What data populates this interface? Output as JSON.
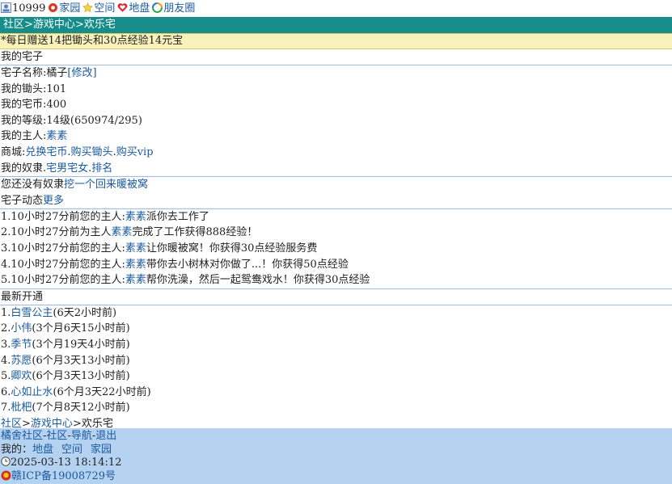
{
  "topbar": {
    "user_id": "10999",
    "links": [
      "家园",
      "空间",
      "地盘",
      "朋友圈"
    ]
  },
  "breadcrumb": {
    "community": "社区",
    "sep": ">",
    "game_center": "游戏中心",
    "current": "欢乐宅"
  },
  "notice": "*每日赠送14把锄头和30点经验14元宝",
  "my_house": {
    "title": "我的宅子",
    "name_label": "宅子名称:",
    "name_value": "橘子",
    "edit_link": "[修改]",
    "hoe": "我的锄头:101",
    "coins": "我的宅币:400",
    "level": "我的等级:14级(650974/295)",
    "master_label": "我的主人:",
    "master_name": "素素",
    "shop_label": "商城:",
    "shop_links": [
      "兑换宅币",
      "购买锄头",
      "购买vip"
    ],
    "slaves_label": "我的奴隶.",
    "slaves_links": [
      "宅男宅女",
      "排名"
    ]
  },
  "no_slave": {
    "text": "您还没有奴隶",
    "link": "挖一个回来暖被窝"
  },
  "dynamics": {
    "title": "宅子动态",
    "more": "更多",
    "items": [
      {
        "pre": "1.10小时27分前您的主人:",
        "name": "素素",
        "post": "派你去工作了"
      },
      {
        "pre": "2.10小时27分前为主人",
        "name": "素素",
        "post": "完成了工作获得888经验！"
      },
      {
        "pre": "3.10小时27分前您的主人:",
        "name": "素素",
        "post": "让你暖被窝！你获得30点经验服务费"
      },
      {
        "pre": "4.10小时27分前您的主人:",
        "name": "素素",
        "post": "带你去小树林对你做了...！你获得50点经验"
      },
      {
        "pre": "5.10小时27分前您的主人:",
        "name": "素素",
        "post": "帮你洗澡，然后一起鸳鸯戏水！你获得30点经验"
      }
    ]
  },
  "newest": {
    "title": "最新开通",
    "items": [
      {
        "num": "1.",
        "name": "白雪公主",
        "time": "(6天2小时前)"
      },
      {
        "num": "2.",
        "name": "小伟",
        "time": "(3个月6天15小时前)"
      },
      {
        "num": "3.",
        "name": "季节",
        "time": "(3个月19天4小时前)"
      },
      {
        "num": "4.",
        "name": "苏愿",
        "time": "(6个月3天13小时前)"
      },
      {
        "num": "5.",
        "name": "卿欢",
        "time": "(6个月3天13小时前)"
      },
      {
        "num": "6.",
        "name": "心如止水",
        "time": "(6个月3天22小时前)"
      },
      {
        "num": "7.",
        "name": "枇杷",
        "time": "(7个月8天12小时前)"
      }
    ]
  },
  "bottom_breadcrumb": {
    "community": "社区",
    "game_center": "游戏中心",
    "current": "欢乐宅"
  },
  "footer": {
    "links": [
      "橘舍社区",
      "社区",
      "导航",
      "退出"
    ],
    "my_label": "我的：",
    "my_links": [
      "地盘",
      "空间",
      "家园"
    ],
    "datetime": "2025-03-13 18:14:12",
    "icp": "赣ICP备19008729号"
  },
  "colors": {
    "accent": "#168d8a",
    "link": "#1a5aa0",
    "notice_bg": "#f9f3bb",
    "footer_bg": "#b5d3f1"
  }
}
